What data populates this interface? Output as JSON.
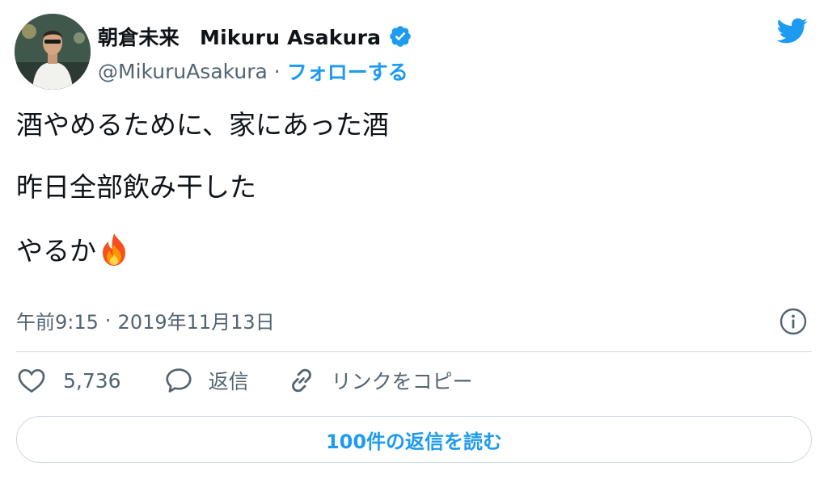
{
  "author": {
    "display_name": "朝倉未来　Mikuru Asakura",
    "handle": "@MikuruAsakura",
    "separator": "·",
    "follow_label": "フォローする",
    "verified": true
  },
  "tweet": {
    "lines": [
      "酒やめるために、家にあった酒",
      "昨日全部飲み干した",
      "やるか"
    ],
    "emoji": "fire-emoji"
  },
  "meta": {
    "time": "午前9:15",
    "separator": "·",
    "date": "2019年11月13日"
  },
  "actions": {
    "like_count": "5,736",
    "reply_label": "返信",
    "copy_link_label": "リンクをコピー"
  },
  "read_replies_label": "100件の返信を読む",
  "colors": {
    "accent": "#1d9bf0",
    "text": "#0f1419",
    "secondary": "#536471",
    "border": "#cfd9de"
  },
  "icons": {
    "brand": "twitter-bird-icon",
    "verified": "verified-badge-icon",
    "info": "info-icon",
    "like": "heart-icon",
    "reply": "speech-bubble-icon",
    "copy": "link-icon"
  }
}
